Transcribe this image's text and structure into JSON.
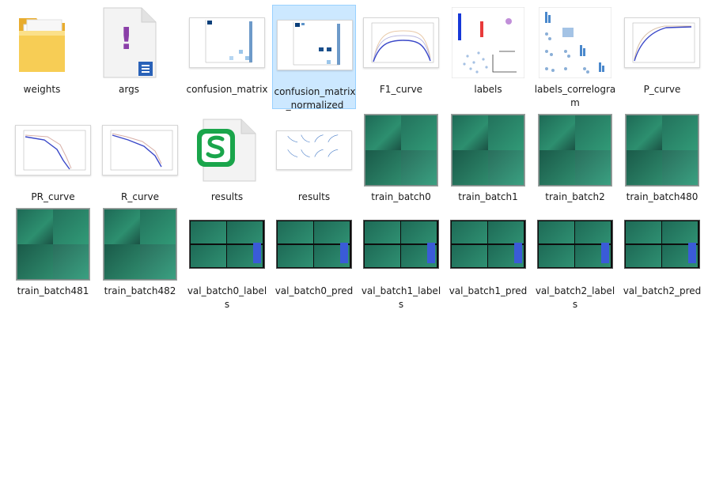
{
  "files": [
    {
      "name": "weights",
      "kind": "folder-icon"
    },
    {
      "name": "args",
      "kind": "text-file-icon"
    },
    {
      "name": "confusion_matrix",
      "kind": "image-chart"
    },
    {
      "name": "confusion_matrix_normalized",
      "kind": "image-chart",
      "selected": true
    },
    {
      "name": "F1_curve",
      "kind": "image-chart"
    },
    {
      "name": "labels",
      "kind": "image-chart"
    },
    {
      "name": "labels_correlogram",
      "kind": "image-chart"
    },
    {
      "name": "P_curve",
      "kind": "image-chart"
    },
    {
      "name": "PR_curve",
      "kind": "image-chart"
    },
    {
      "name": "R_curve",
      "kind": "image-chart"
    },
    {
      "name": "results",
      "kind": "spreadsheet-file-icon"
    },
    {
      "name": "results",
      "kind": "image-chart"
    },
    {
      "name": "train_batch0",
      "kind": "image-photo"
    },
    {
      "name": "train_batch1",
      "kind": "image-photo"
    },
    {
      "name": "train_batch2",
      "kind": "image-photo"
    },
    {
      "name": "train_batch480",
      "kind": "image-photo"
    },
    {
      "name": "train_batch481",
      "kind": "image-photo"
    },
    {
      "name": "train_batch482",
      "kind": "image-photo"
    },
    {
      "name": "val_batch0_labels",
      "kind": "image-val"
    },
    {
      "name": "val_batch0_pred",
      "kind": "image-val"
    },
    {
      "name": "val_batch1_labels",
      "kind": "image-val"
    },
    {
      "name": "val_batch1_pred",
      "kind": "image-val"
    },
    {
      "name": "val_batch2_labels",
      "kind": "image-val"
    },
    {
      "name": "val_batch2_pred",
      "kind": "image-val"
    }
  ],
  "colors": {
    "selection_bg": "#cce8ff",
    "selection_border": "#99d1ff",
    "folder": "#f4c542",
    "accent_green": "#1aa54b",
    "accent_purple": "#8a3fa8"
  }
}
